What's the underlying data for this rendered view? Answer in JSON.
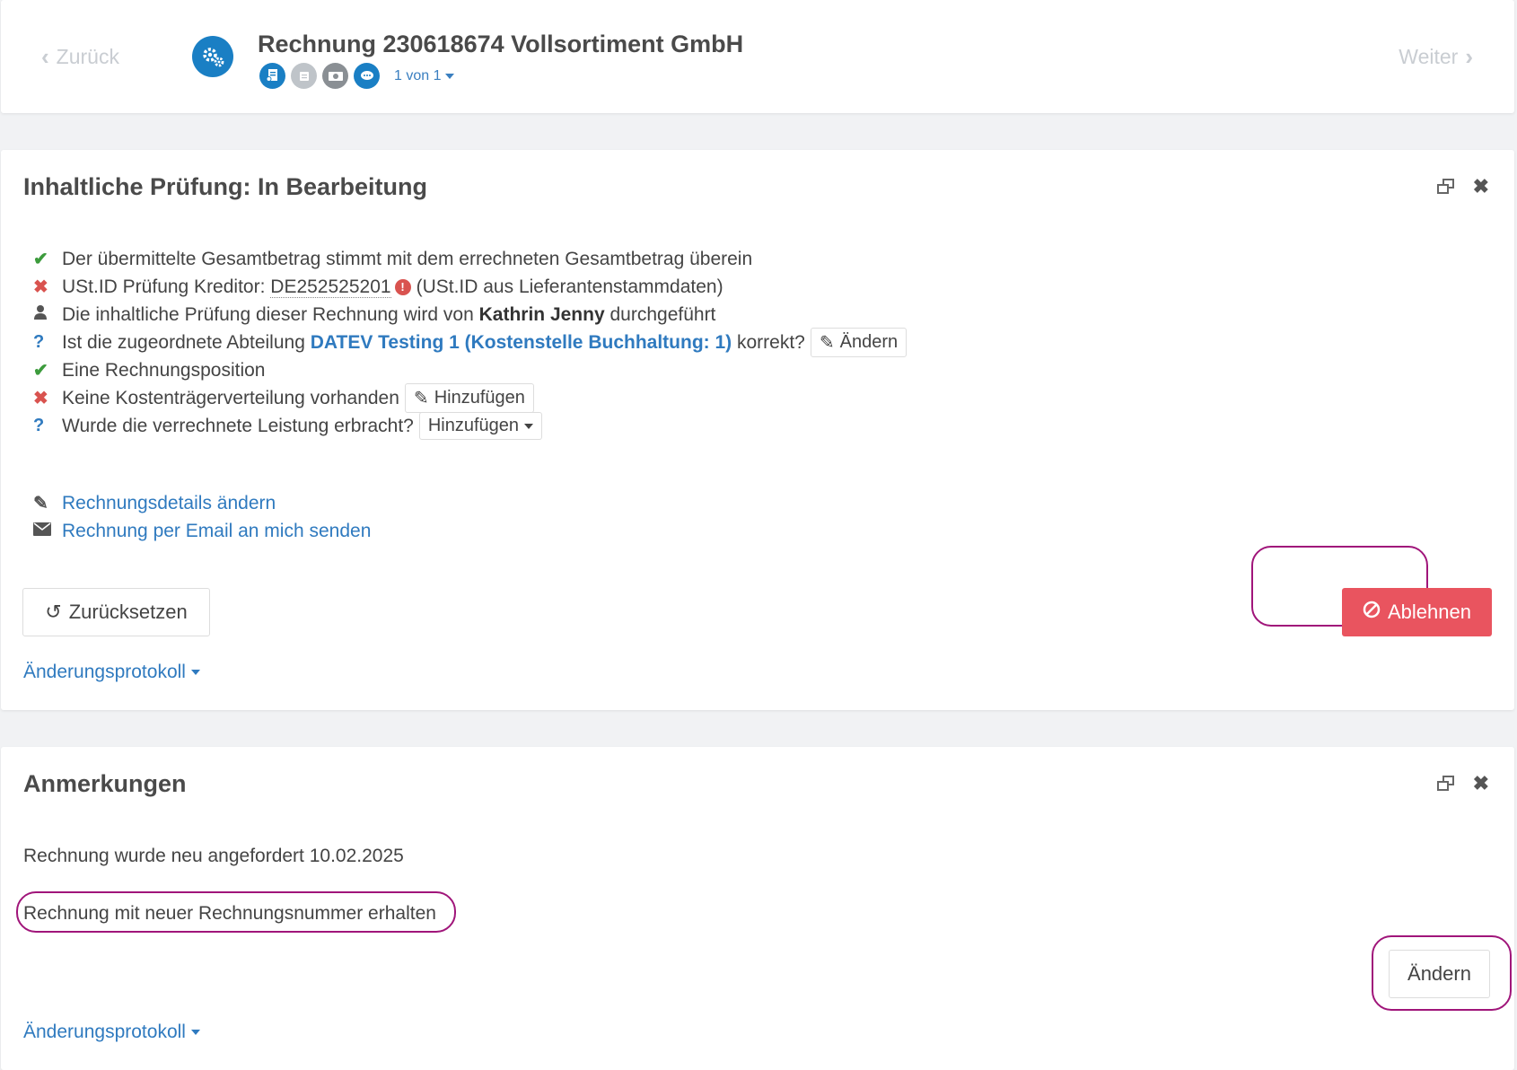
{
  "header": {
    "back_label": "Zurück",
    "next_label": "Weiter",
    "title": "Rechnung 230618674 Vollsortiment GmbH",
    "pager": "1 von 1"
  },
  "panel1": {
    "title": "Inhaltliche Prüfung: In Bearbeitung",
    "checks": {
      "total": "Der übermittelte Gesamtbetrag stimmt mit dem errechneten Gesamtbetrag überein",
      "ust_prefix": "USt.ID Prüfung Kreditor:",
      "ust_id": "DE252525201",
      "ust_suffix": "(USt.ID aus Lieferantenstammdaten)",
      "reviewer_prefix": "Die inhaltliche Prüfung dieser Rechnung wird von",
      "reviewer_name": "Kathrin Jenny",
      "reviewer_suffix": "durchgeführt",
      "dept_prefix": "Ist die zugeordnete Abteilung",
      "dept_name": "DATEV Testing 1 (Kostenstelle Buchhaltung: 1)",
      "dept_suffix": "korrekt?",
      "dept_button": "Ändern",
      "position": "Eine Rechnungsposition",
      "cost_carrier": "Keine Kostenträgerverteilung vorhanden",
      "cost_carrier_button": "Hinzufügen",
      "service_question": "Wurde die verrechnete Leistung erbracht?",
      "service_button": "Hinzufügen"
    },
    "links": {
      "edit_details": "Rechnungsdetails ändern",
      "send_email": "Rechnung per Email an mich senden"
    },
    "reset_button": "Zurücksetzen",
    "reject_button": "Ablehnen",
    "protocol": "Änderungsprotokoll"
  },
  "panel2": {
    "title": "Anmerkungen",
    "note1": "Rechnung wurde neu angefordert 10.02.2025",
    "note2": "Rechnung mit neuer Rechnungsnummer erhalten",
    "change_button": "Ändern",
    "protocol": "Änderungsprotokoll"
  },
  "colors": {
    "accent": "#2f7abf",
    "reject": "#e9545f",
    "success": "#3c9b3c",
    "error": "#d9534f",
    "highlight": "#a0157a"
  }
}
